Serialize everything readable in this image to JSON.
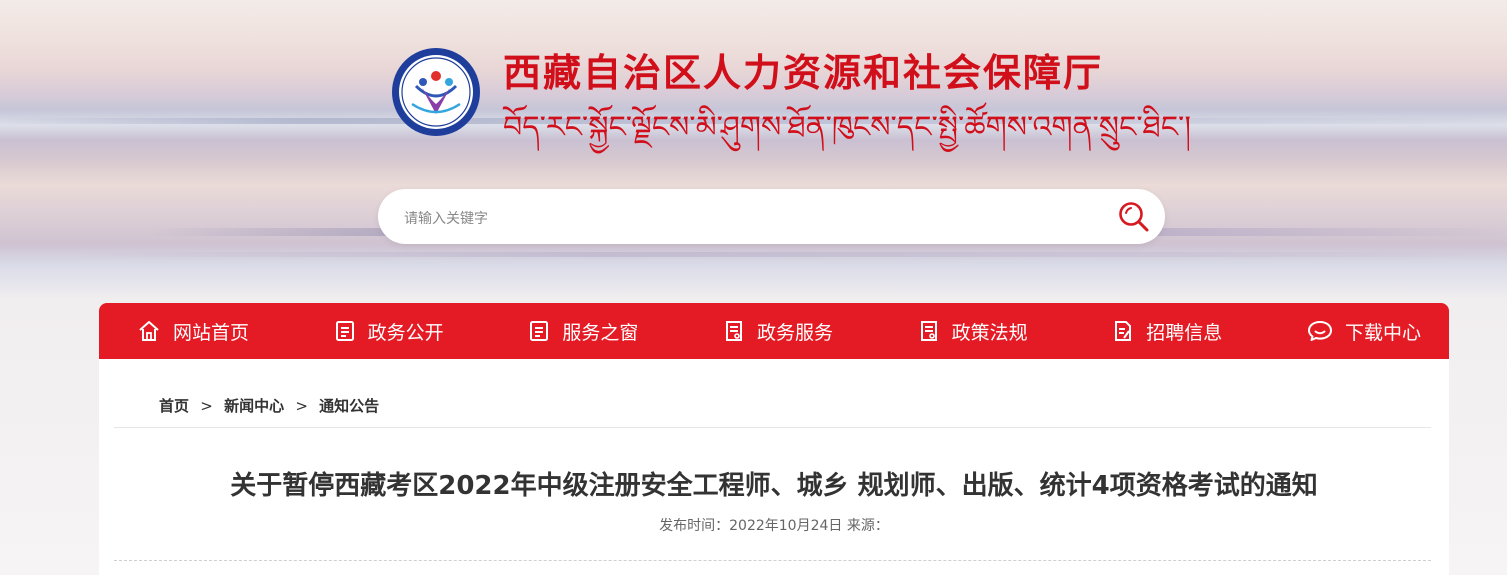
{
  "header": {
    "title_cn": "西藏自治区人力资源和社会保障厅",
    "title_tibetan": "བོད་རང་སྐྱོང་ལྗོངས་མི་ཤུགས་ཐོན་ཁུངས་དང་སྤྱི་ཚོགས་འགན་སྲུང་ཐིང་།",
    "logo_icon": "people-emblem-logo",
    "brand_color": "#d10f1b"
  },
  "search": {
    "placeholder": "请输入关键字",
    "value": "",
    "icon": "search-icon"
  },
  "nav": {
    "color": "#e41b25",
    "items": [
      {
        "label": "网站首页",
        "icon": "home-icon"
      },
      {
        "label": "政务公开",
        "icon": "document-icon"
      },
      {
        "label": "服务之窗",
        "icon": "document-icon"
      },
      {
        "label": "政务服务",
        "icon": "form-icon"
      },
      {
        "label": "政策法规",
        "icon": "form-icon"
      },
      {
        "label": "招聘信息",
        "icon": "edit-document-icon"
      },
      {
        "label": "下载中心",
        "icon": "chat-icon"
      }
    ]
  },
  "breadcrumb": {
    "items": [
      "首页",
      "新闻中心",
      "通知公告"
    ],
    "separator": ">"
  },
  "article": {
    "title": "关于暂停西藏考区2022年中级注册安全工程师、城乡 规划师、出版、统计4项资格考试的通知",
    "meta": "发布时间：2022年10月24日 来源："
  }
}
